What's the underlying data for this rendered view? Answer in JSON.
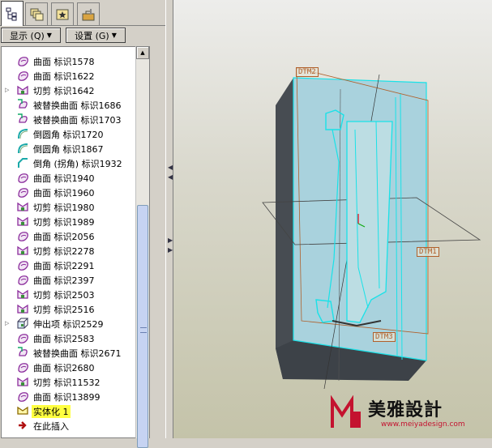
{
  "tabs": [
    {
      "name": "model-tree-tab",
      "icon": "model-tree-icon",
      "active": true
    },
    {
      "name": "layers-tab",
      "icon": "layers-icon",
      "active": false
    },
    {
      "name": "favorites-tab",
      "icon": "favorites-icon",
      "active": false
    },
    {
      "name": "tools-tab",
      "icon": "toolbox-icon",
      "active": false
    }
  ],
  "toolbar": {
    "show_label": "显示 (Q)",
    "settings_label": "设置 (G)"
  },
  "tree": {
    "items": [
      {
        "icon": "surface-icon",
        "label": "曲面 标识1578",
        "expandable": false
      },
      {
        "icon": "surface-icon",
        "label": "曲面 标识1622",
        "expandable": false
      },
      {
        "icon": "cut-icon",
        "label": "切剪 标识1642",
        "expandable": true
      },
      {
        "icon": "replace-surface-icon",
        "label": "被替换曲面 标识1686",
        "expandable": false
      },
      {
        "icon": "replace-surface-icon",
        "label": "被替换曲面 标识1703",
        "expandable": false
      },
      {
        "icon": "round-icon",
        "label": "倒圆角 标识1720",
        "expandable": false
      },
      {
        "icon": "round-icon",
        "label": "倒圆角 标识1867",
        "expandable": false
      },
      {
        "icon": "chamfer-icon",
        "label": "倒角 (拐角) 标识1932",
        "expandable": false
      },
      {
        "icon": "surface-icon",
        "label": "曲面 标识1940",
        "expandable": false
      },
      {
        "icon": "surface-icon",
        "label": "曲面 标识1960",
        "expandable": false
      },
      {
        "icon": "cut-icon",
        "label": "切剪 标识1980",
        "expandable": false
      },
      {
        "icon": "cut-icon",
        "label": "切剪 标识1989",
        "expandable": false
      },
      {
        "icon": "surface-icon",
        "label": "曲面 标识2056",
        "expandable": false
      },
      {
        "icon": "cut-icon",
        "label": "切剪 标识2278",
        "expandable": false
      },
      {
        "icon": "surface-icon",
        "label": "曲面 标识2291",
        "expandable": false
      },
      {
        "icon": "surface-icon",
        "label": "曲面 标识2397",
        "expandable": false
      },
      {
        "icon": "cut-icon",
        "label": "切剪 标识2503",
        "expandable": false
      },
      {
        "icon": "cut-icon",
        "label": "切剪 标识2516",
        "expandable": false
      },
      {
        "icon": "extrude-icon",
        "label": "伸出项 标识2529",
        "expandable": true
      },
      {
        "icon": "surface-icon",
        "label": "曲面 标识2583",
        "expandable": false
      },
      {
        "icon": "replace-surface-icon",
        "label": "被替换曲面 标识2671",
        "expandable": false
      },
      {
        "icon": "surface-icon",
        "label": "曲面 标识2680",
        "expandable": false
      },
      {
        "icon": "cut-icon",
        "label": "切剪 标识11532",
        "expandable": false
      },
      {
        "icon": "surface-icon",
        "label": "曲面 标识13899",
        "expandable": false
      },
      {
        "icon": "solidify-icon",
        "label": "实体化 1",
        "expandable": false,
        "selected": true
      },
      {
        "icon": "insert-here-icon",
        "label": "在此插入",
        "expandable": false
      }
    ]
  },
  "viewport": {
    "datums": {
      "top": "DTM2",
      "right": "DTM1",
      "bottom": "DTM3"
    }
  },
  "watermark": {
    "title": "美雅設計",
    "url": "www.meiyadesign.com"
  },
  "colors": {
    "block_face": "#a9d2dd",
    "block_side": "#474c52",
    "edge_highlight": "#19e2e8",
    "datum": "#b0602b",
    "selection": "#ffff40",
    "icon_purple": "#8b2c9c",
    "icon_teal": "#1aa9a9"
  }
}
